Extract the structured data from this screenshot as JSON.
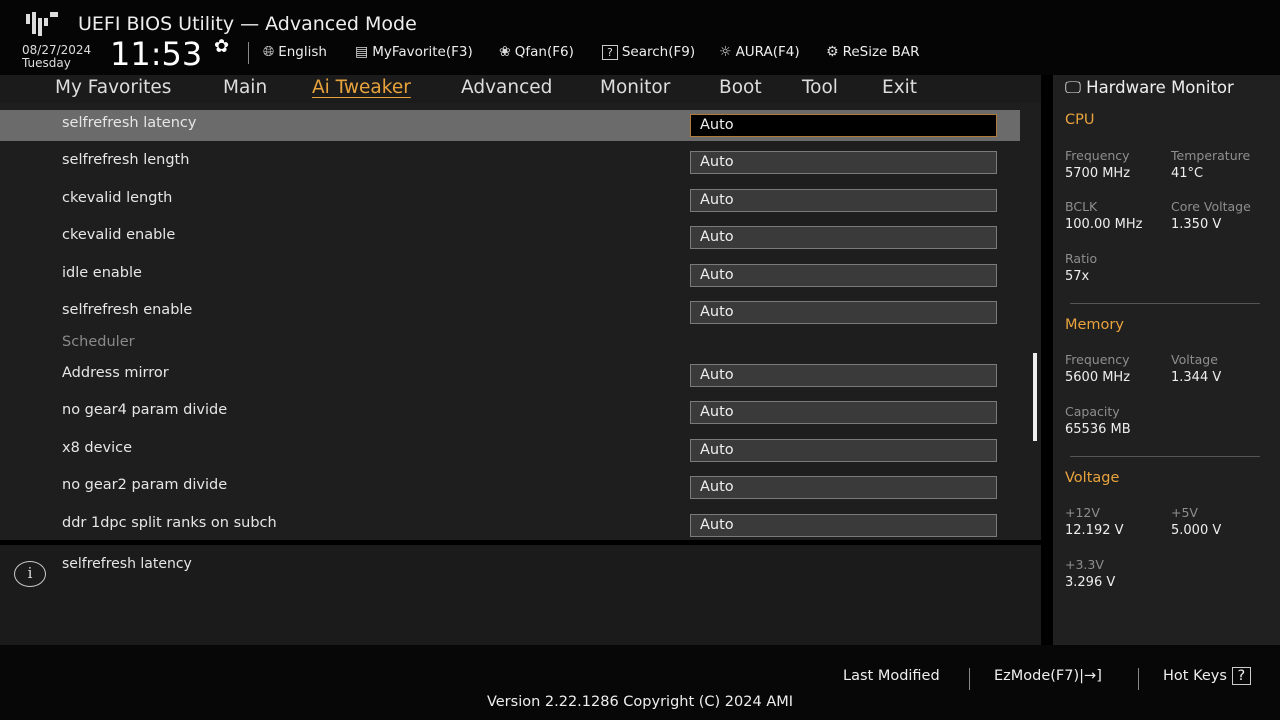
{
  "header": {
    "title": "UEFI BIOS Utility — Advanced Mode",
    "date": "08/27/2024",
    "day": "Tuesday",
    "time": "11:53",
    "tools": [
      {
        "icon": "globe-icon",
        "label": "English"
      },
      {
        "icon": "favorite-list-icon",
        "label": "MyFavorite(F3)"
      },
      {
        "icon": "fan-icon",
        "label": "Qfan(F6)"
      },
      {
        "icon": "help-box-icon",
        "label": "Search(F9)"
      },
      {
        "icon": "aura-icon",
        "label": "AURA(F4)"
      },
      {
        "icon": "resize-bar-icon",
        "label": "ReSize BAR"
      }
    ]
  },
  "tabs": [
    "My Favorites",
    "Main",
    "Ai Tweaker",
    "Advanced",
    "Monitor",
    "Boot",
    "Tool",
    "Exit"
  ],
  "active_tab": "Ai Tweaker",
  "settings": [
    {
      "label": "selfrefresh latency",
      "value": "Auto"
    },
    {
      "label": "selfrefresh length",
      "value": "Auto"
    },
    {
      "label": "ckevalid length",
      "value": "Auto"
    },
    {
      "label": "ckevalid enable",
      "value": "Auto"
    },
    {
      "label": "idle enable",
      "value": "Auto"
    },
    {
      "label": "selfrefresh enable",
      "value": "Auto"
    },
    {
      "label": "Scheduler",
      "section": true
    },
    {
      "label": "Address mirror",
      "value": "Auto"
    },
    {
      "label": "no gear4 param divide",
      "value": "Auto"
    },
    {
      "label": "x8 device",
      "value": "Auto"
    },
    {
      "label": "no gear2 param divide",
      "value": "Auto"
    },
    {
      "label": "ddr 1dpc split ranks on subch",
      "value": "Auto"
    }
  ],
  "info": {
    "text": "selfrefresh latency"
  },
  "hw": {
    "title": "Hardware Monitor",
    "cpu": {
      "title": "CPU",
      "freq_l": "Frequency",
      "freq": "5700 MHz",
      "temp_l": "Temperature",
      "temp": "41°C",
      "bclk_l": "BCLK",
      "bclk": "100.00 MHz",
      "cv_l": "Core Voltage",
      "cv": "1.350 V",
      "ratio_l": "Ratio",
      "ratio": "57x"
    },
    "mem": {
      "title": "Memory",
      "freq_l": "Frequency",
      "freq": "5600 MHz",
      "volt_l": "Voltage",
      "volt": "1.344 V",
      "cap_l": "Capacity",
      "cap": "65536 MB"
    },
    "volt": {
      "title": "Voltage",
      "v12_l": "+12V",
      "v12": "12.192 V",
      "v5_l": "+5V",
      "v5": "5.000 V",
      "v33_l": "+3.3V",
      "v33": "3.296 V"
    }
  },
  "footer": {
    "last_modified": "Last Modified",
    "ezmode": "EzMode(F7)|",
    "hotkeys": "Hot Keys",
    "version": "Version 2.22.1286 Copyright (C) 2024 AMI"
  },
  "colors": {
    "accent": "#e8a33d",
    "highlight_row": "#6b6b6b"
  }
}
